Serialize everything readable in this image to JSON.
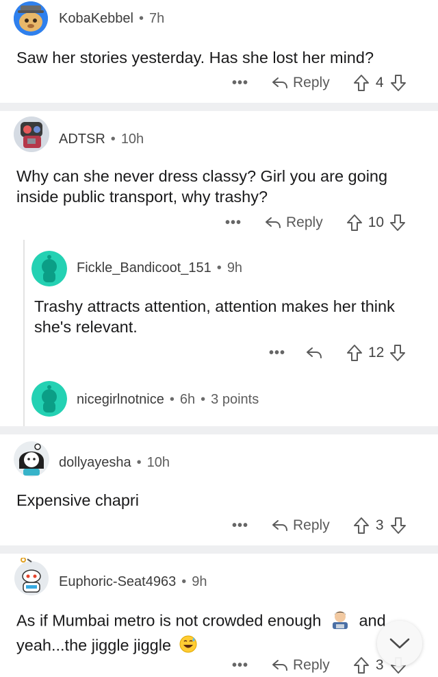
{
  "comments": [
    {
      "author": "KobaKebbel",
      "time": "7h",
      "text": "Saw her stories yesterday. Has she lost her mind?",
      "reply_label": "Reply",
      "score": "4"
    },
    {
      "author": "ADTSR",
      "time": "10h",
      "text": "Why can she never dress classy? Girl you are going inside public transport, why trashy?",
      "reply_label": "Reply",
      "score": "10"
    },
    {
      "author": "Fickle_Bandicoot_151",
      "time": "9h",
      "text": "Trashy attracts attention, attention makes her think she's relevant.",
      "score": "12"
    },
    {
      "author": "nicegirlnotnice",
      "time": "6h",
      "points": "3 points"
    },
    {
      "author": "dollyayesha",
      "time": "10h",
      "text": "Expensive chapri",
      "reply_label": "Reply",
      "score": "3"
    },
    {
      "author": "Euphoric-Seat4963",
      "time": "9h",
      "text_line1": "As if Mumbai metro is not crowded enough",
      "text_line1_tail": "and",
      "text_line2": "yeah...the jiggle jiggle",
      "reply_label": "Reply",
      "score": "3"
    }
  ],
  "more_label": "•••",
  "dot": "•",
  "colors": {
    "separator": "#eeeff1",
    "snoo_teal": "#24d1b3",
    "text": "#1a1a1b",
    "meta": "#5d5d5d"
  },
  "icons": {
    "reply": "reply-arrow-icon",
    "upvote": "upvote-arrow-icon",
    "downvote": "downvote-arrow-icon",
    "scroll": "chevron-down-icon"
  }
}
